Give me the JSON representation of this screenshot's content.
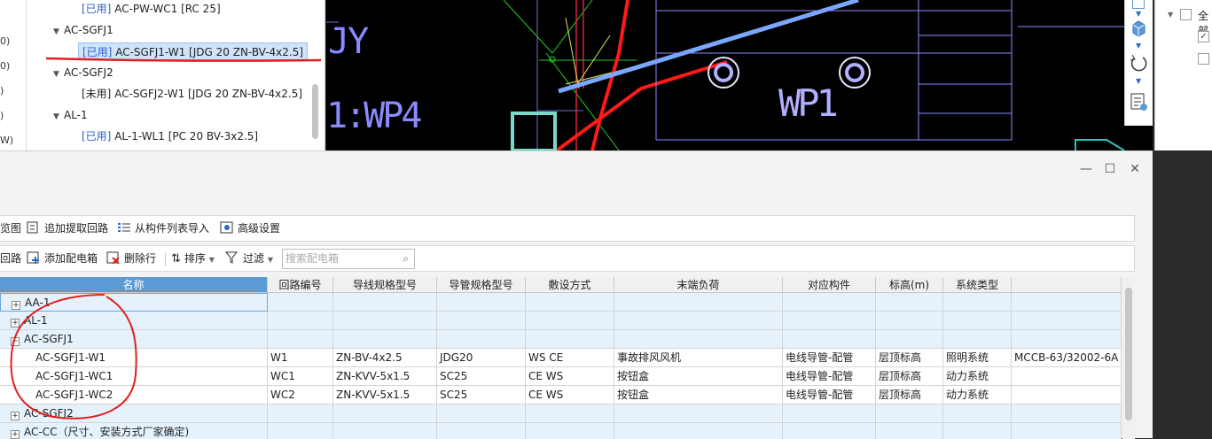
{
  "tree": {
    "left_strip": [
      "0)",
      "0)",
      ")",
      ")",
      "W)"
    ],
    "nodes": [
      {
        "label": "[已用] AC-PW-WC1 [RC 25]",
        "status": "[已用]",
        "text": "AC-PW-WC1 [RC 25]"
      },
      {
        "label": "AC-SGFJ1"
      },
      {
        "status": "[已用]",
        "text": "AC-SGFJ1-W1 [JDG 20 ZN-BV-4x2.5]"
      },
      {
        "label": "AC-SGFJ2"
      },
      {
        "status": "[未用]",
        "text": "AC-SGFJ2-W1 [JDG 20 ZN-BV-4x2.5]"
      },
      {
        "label": "AL-1"
      },
      {
        "status": "[已用]",
        "text": "AL-1-WL1 [PC 20 BV-3x2.5]"
      }
    ]
  },
  "cad": {
    "labels": [
      "JY",
      "1:WP4",
      "WP1"
    ]
  },
  "right_panel": {
    "checkbox_label": "全部"
  },
  "toolbar1": {
    "b0": "览图",
    "b1": "追加提取回路",
    "b2": "从构件列表导入",
    "b3": "高级设置"
  },
  "toolbar2": {
    "b0": "回路",
    "b1": "添加配电箱",
    "b2": "删除行",
    "b3": "排序",
    "b4": "过滤",
    "search_placeholder": "搜索配电箱"
  },
  "table": {
    "columns": [
      "名称",
      "回路编号",
      "导线规格型号",
      "导管规格型号",
      "敷设方式",
      "末端负荷",
      "对应构件",
      "标高(m)",
      "系统类型",
      ""
    ],
    "rows": [
      {
        "type": "group",
        "expanded": false,
        "name": "AA-1"
      },
      {
        "type": "group",
        "expanded": false,
        "name": "AL-1"
      },
      {
        "type": "group",
        "expanded": true,
        "name": "AC-SGFJ1"
      },
      {
        "type": "item",
        "name": "AC-SGFJ1-W1",
        "circuit": "W1",
        "wire": "ZN-BV-4x2.5",
        "conduit": "JDG20",
        "laying": "WS CE",
        "load": "事故排风风机",
        "component": "电线导管-配管",
        "elevation": "层顶标高",
        "system": "照明系统",
        "extra": "MCCB-63/32002-6A"
      },
      {
        "type": "item",
        "name": "AC-SGFJ1-WC1",
        "circuit": "WC1",
        "wire": "ZN-KVV-5x1.5",
        "conduit": "SC25",
        "laying": "CE WS",
        "load": "按钮盒",
        "component": "电线导管-配管",
        "elevation": "层顶标高",
        "system": "动力系统",
        "extra": ""
      },
      {
        "type": "item",
        "name": "AC-SGFJ1-WC2",
        "circuit": "WC2",
        "wire": "ZN-KVV-5x1.5",
        "conduit": "SC25",
        "laying": "CE WS",
        "load": "按钮盒",
        "component": "电线导管-配管",
        "elevation": "层顶标高",
        "system": "动力系统",
        "extra": ""
      },
      {
        "type": "group",
        "expanded": false,
        "name": "AC-SGFJ2"
      },
      {
        "type": "group",
        "expanded": false,
        "name": "AC-CC（尺寸、安装方式厂家确定)"
      }
    ]
  },
  "colors": {
    "accent": "#5b9bd5",
    "used": "#2a62c9",
    "annotation": "#e02020"
  }
}
